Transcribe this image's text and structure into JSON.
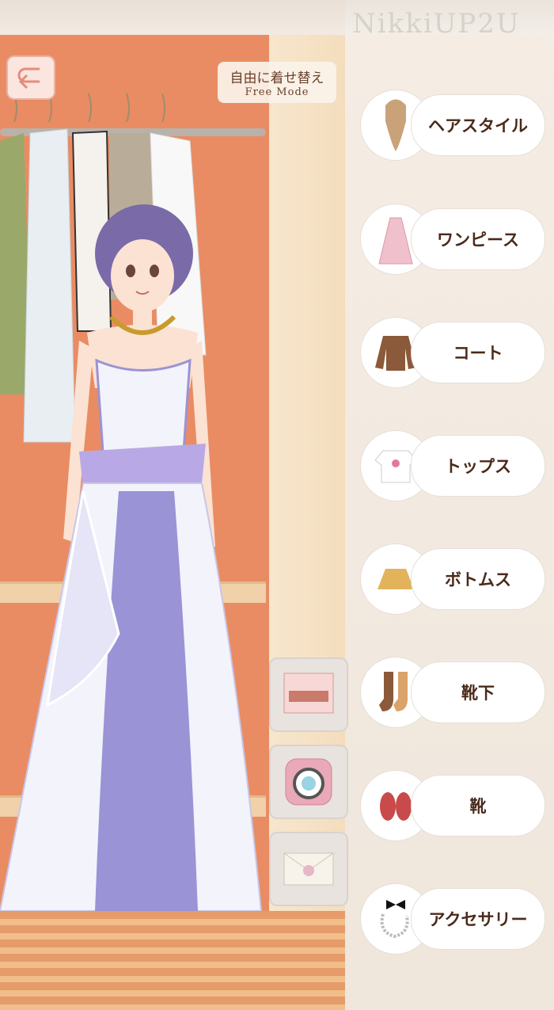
{
  "header": {
    "logo_text": "NikkiUP2U",
    "back_label": "戻る",
    "mode_title": "自由に着せ替え",
    "mode_subtitle": "Free Mode"
  },
  "categories": [
    {
      "label": "ヘアスタイル",
      "icon": "hairstyle-icon"
    },
    {
      "label": "ワンピース",
      "icon": "dress-icon"
    },
    {
      "label": "コート",
      "icon": "coat-icon"
    },
    {
      "label": "トップス",
      "icon": "tops-icon"
    },
    {
      "label": "ボトムス",
      "icon": "skirt-icon"
    },
    {
      "label": "靴下",
      "icon": "socks-icon"
    },
    {
      "label": "靴",
      "icon": "shoes-icon"
    },
    {
      "label": "アクセサリー",
      "icon": "accessory-icon"
    }
  ],
  "side_buttons": [
    {
      "icon": "background-scene-icon"
    },
    {
      "icon": "camera-icon"
    },
    {
      "icon": "letter-icon"
    }
  ],
  "colors": {
    "closet": "#e98c63",
    "panel": "#f5ede4",
    "label_text": "#4a2a1a",
    "dress_main": "#f3f3fb",
    "dress_accent": "#9a93d6"
  }
}
